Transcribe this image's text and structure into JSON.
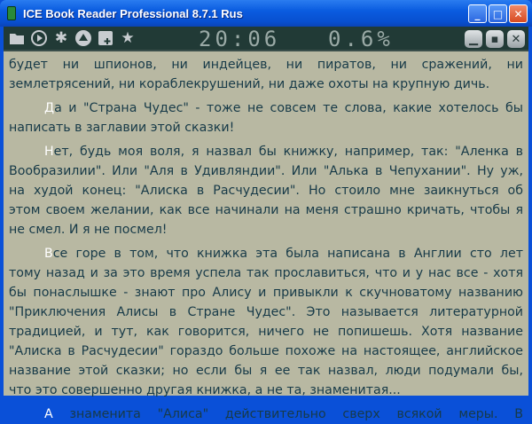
{
  "window": {
    "title": "ICE Book Reader Professional 8.7.1 Rus",
    "buttons": {
      "minimize": "_",
      "maximize": "□",
      "close": "✕"
    }
  },
  "toolbar": {
    "icons": [
      "folder-icon",
      "play-icon",
      "settings-icon",
      "eject-icon",
      "add-bookmark-icon",
      "star-icon"
    ],
    "clock": "20:06",
    "progress_text": "0.6%",
    "progress": 0.6
  },
  "book": {
    "paragraphs": [
      {
        "initial": "",
        "lines": [
          "будет ни шпионов, ни индейцев, ни пиратов, ни сражений, ни",
          "землетрясений, ни кораблекрушений, ни даже охоты на крупную дичь."
        ]
      },
      {
        "initial": "Д",
        "lines": [
          "а и \"Страна Чудес\" - тоже не совсем те слова, какие хотелось бы",
          "написать в заглавии этой сказки!"
        ]
      },
      {
        "initial": "Н",
        "lines": [
          "ет, будь моя воля, я назвал бы книжку, например, так: \"Аленка в",
          "Вообразилии\". Или \"Аля в Удивляндии\". Или \"Алька в Чепухании\". Ну уж,",
          "на худой конец: \"Алиска в Расчудесии\". Но стоило мне заикнуться об",
          "этом своем желании, как все начинали на меня страшно кричать, чтобы я",
          "не смел. И я не посмел!"
        ]
      },
      {
        "initial": "В",
        "lines": [
          "се горе в том, что книжка эта была написана в Англии сто лет",
          "тому назад и за это время успела так прославиться, что и у нас все - хотя",
          "бы понаслышке - знают про Алису и привыкли к скучноватому названию",
          "\"Приключения Алисы в Стране Чудес\". Это называется литературной",
          "традицией, и тут, как говорится, ничего не попишешь. Хотя название",
          "\"Алиска в Расчудесии\" гораздо больше похоже на настоящее, английское",
          "название этой сказки; но если бы я ее так назвал, люди подумали бы,",
          "что это совершенно другая книжка, а не та, знаменитая..."
        ]
      },
      {
        "initial": "А",
        "lines": [
          " знаменита \"Алиса\" действительно сверх всякой меры. В"
        ]
      }
    ]
  }
}
